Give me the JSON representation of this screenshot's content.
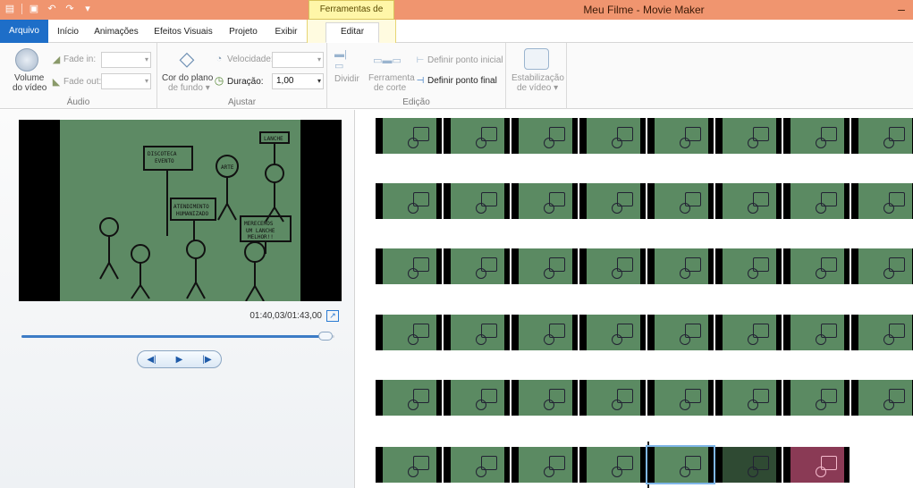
{
  "titlebar": {
    "context_tab": "Ferramentas de Vídeo",
    "title": "Meu Filme - Movie Maker",
    "minimize": "–"
  },
  "tabs": {
    "file": "Arquivo",
    "home": "Início",
    "animations": "Animações",
    "visual_effects": "Efeitos Visuais",
    "project": "Projeto",
    "view": "Exibir",
    "edit": "Editar"
  },
  "ribbon": {
    "audio": {
      "volume_line1": "Volume",
      "volume_line2": "do vídeo",
      "fade_in": "Fade in:",
      "fade_out": "Fade out:",
      "label": "Áudio"
    },
    "adjust": {
      "bg_color_line1": "Cor do plano",
      "bg_color_line2": "de fundo ▾",
      "speed": "Velocidade:",
      "duration": "Duração:",
      "duration_value": "1,00",
      "label": "Ajustar"
    },
    "edit": {
      "split": "Dividir",
      "trim_line1": "Ferramenta",
      "trim_line2": "de corte",
      "set_start": "Definir ponto inicial",
      "set_end": "Definir ponto final",
      "label": "Edição"
    },
    "stabilize": {
      "line1": "Estabilização",
      "line2": "de vídeo ▾"
    }
  },
  "preview": {
    "time": "01:40,03/01:43,00",
    "progress": 0.97
  },
  "storyboard": {
    "rows": 6
  }
}
